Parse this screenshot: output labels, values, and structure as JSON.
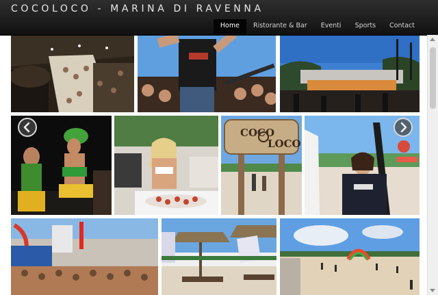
{
  "header": {
    "brand": "COCOLOCO - MARINA DI RAVENNA",
    "nav": [
      {
        "label": "Home",
        "active": true
      },
      {
        "label": "Ristorante & Bar",
        "active": false
      },
      {
        "label": "Eventi",
        "active": false
      },
      {
        "label": "Sports",
        "active": false
      },
      {
        "label": "Contact",
        "active": false
      }
    ]
  },
  "gallery": {
    "sign_text_top": "COCO",
    "sign_text_bottom": "LOCO",
    "left_arrow_icon": "chevron-left-icon",
    "right_arrow_icon": "chevron-right-icon"
  },
  "colors": {
    "header_bg": "#1c1c1c",
    "nav_active_bg": "#050505",
    "sky": "#5f9fe0"
  }
}
